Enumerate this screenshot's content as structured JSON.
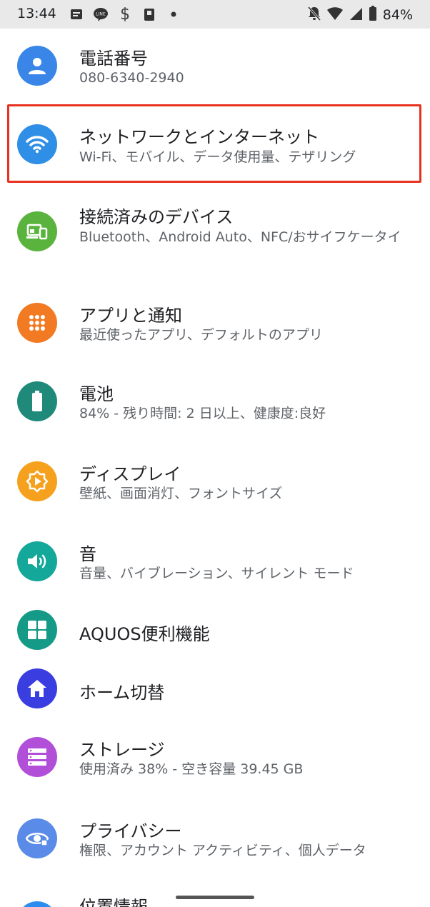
{
  "status_bar": {
    "time": "13:44",
    "notification_icons": [
      "message-icon",
      "line-icon",
      "s-app-icon",
      "clipboard-icon",
      "dot-icon"
    ],
    "right_icons": [
      "notifications-off-icon",
      "wifi-icon",
      "signal-icon",
      "battery-icon"
    ],
    "battery": "84%"
  },
  "colors": {
    "phone": "#3a86e8",
    "network": "#2f8ee6",
    "devices": "#5ab33c",
    "apps": "#f27a23",
    "battery": "#1f8a7a",
    "display": "#f6a11e",
    "sound": "#14a89a",
    "aquos": "#149a86",
    "home": "#3a3ee0",
    "storage": "#b24fd9",
    "privacy": "#5b8be8",
    "location": "#2d8cf0",
    "highlight": "#e8321f"
  },
  "settings": {
    "phone_number": {
      "title": "電話番号",
      "summary": "080-6340-2940"
    },
    "network": {
      "title": "ネットワークとインターネット",
      "summary": "Wi-Fi、モバイル、データ使用量、テザリング"
    },
    "connected_devices": {
      "title": "接続済みのデバイス",
      "summary": "Bluetooth、Android Auto、NFC/おサイフケータイ"
    },
    "apps": {
      "title": "アプリと通知",
      "summary": "最近使ったアプリ、デフォルトのアプリ"
    },
    "battery": {
      "title": "電池",
      "summary": "84% - 残り時間: 2 日以上、健康度:良好"
    },
    "display": {
      "title": "ディスプレイ",
      "summary": "壁紙、画面消灯、フォントサイズ"
    },
    "sound": {
      "title": "音",
      "summary": "音量、バイブレーション、サイレント モード"
    },
    "aquos": {
      "title": "AQUOS便利機能"
    },
    "home_switch": {
      "title": "ホーム切替"
    },
    "storage": {
      "title": "ストレージ",
      "summary": "使用済み 38% - 空き容量 39.45 GB"
    },
    "privacy": {
      "title": "プライバシー",
      "summary": "権限、アカウント アクティビティ、個人データ"
    },
    "location": {
      "title": "位置情報"
    }
  }
}
